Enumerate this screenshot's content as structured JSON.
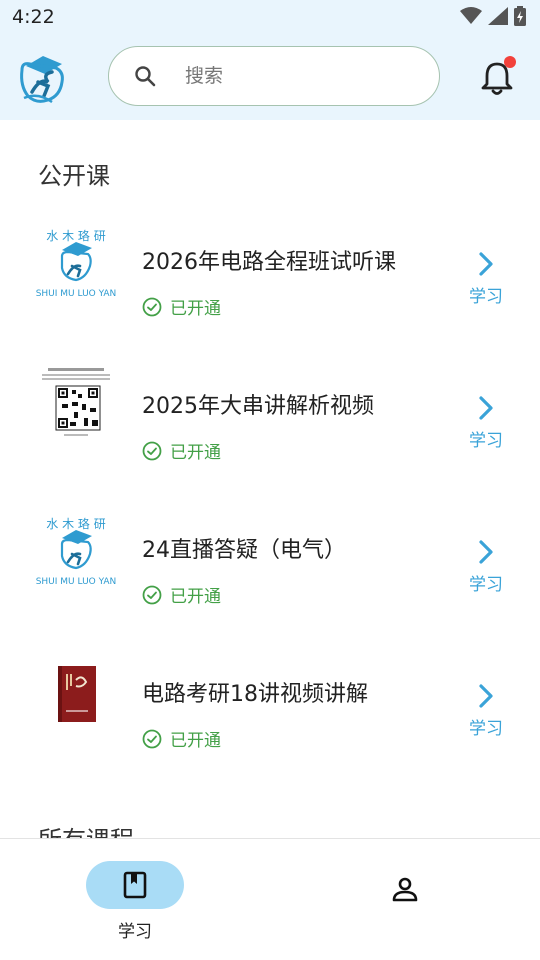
{
  "status_bar": {
    "time": "4:22",
    "icons": [
      "wifi-icon",
      "signal-icon",
      "battery-charging-icon"
    ]
  },
  "header": {
    "logo_icon": "app-logo-icon",
    "search": {
      "placeholder": "搜索",
      "value": ""
    },
    "notification_icon": "bell-icon",
    "notification_badge_color": "#f2413b"
  },
  "section_title": "公开课",
  "courses": [
    {
      "title": "2026年电路全程班试听课",
      "status": "已开通",
      "action": "学习",
      "thumb": "logo-thumbnail"
    },
    {
      "title": "2025年大串讲解析视频",
      "status": "已开通",
      "action": "学习",
      "thumb": "qr-code-thumbnail"
    },
    {
      "title": "24直播答疑（电气）",
      "status": "已开通",
      "action": "学习",
      "thumb": "logo-thumbnail"
    },
    {
      "title": "电路考研18讲视频讲解",
      "status": "已开通",
      "action": "学习",
      "thumb": "book-cover-thumbnail"
    }
  ],
  "next_section_title": "所有课程",
  "bottom_nav": {
    "study_label": "学习",
    "study_icon": "book-icon",
    "profile_icon": "person-icon"
  },
  "colors": {
    "header_bg": "#e9f5fd",
    "accent": "#3aa3d8",
    "status_green": "#43a047",
    "nav_active_pill": "#a9dcf6"
  }
}
